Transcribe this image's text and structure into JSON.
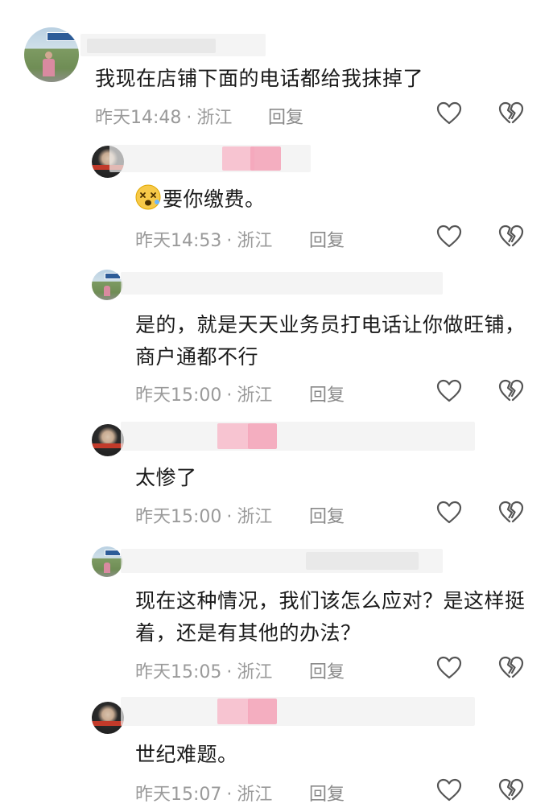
{
  "comments": [
    {
      "text": "我现在店铺下面的电话都给我抹掉了",
      "time": "昨天14:48",
      "location": "浙江",
      "reply": "回复"
    },
    {
      "text": "要你缴费。",
      "time": "昨天14:53",
      "location": "浙江",
      "reply": "回复",
      "emoji": "dizzy-face-emoji"
    },
    {
      "text": "是的，就是天天业务员打电话让你做旺铺，商户通都不行",
      "time": "昨天15:00",
      "location": "浙江",
      "reply": "回复"
    },
    {
      "text": "太惨了",
      "time": "昨天15:00",
      "location": "浙江",
      "reply": "回复"
    },
    {
      "text": "现在这种情况，我们该怎么应对？是这样挺着，还是有其他的办法？",
      "time": "昨天15:05",
      "location": "浙江",
      "reply": "回复"
    },
    {
      "text": "世纪难题。",
      "time": "昨天15:07",
      "location": "浙江",
      "reply": "回复"
    }
  ],
  "icons": {
    "like": "heart-outline-icon",
    "dislike": "broken-heart-icon"
  },
  "colors": {
    "text": "#1a1a1a",
    "meta": "#9a9a9a",
    "icon": "#555555",
    "blur_pink": "#f7b8c8"
  }
}
